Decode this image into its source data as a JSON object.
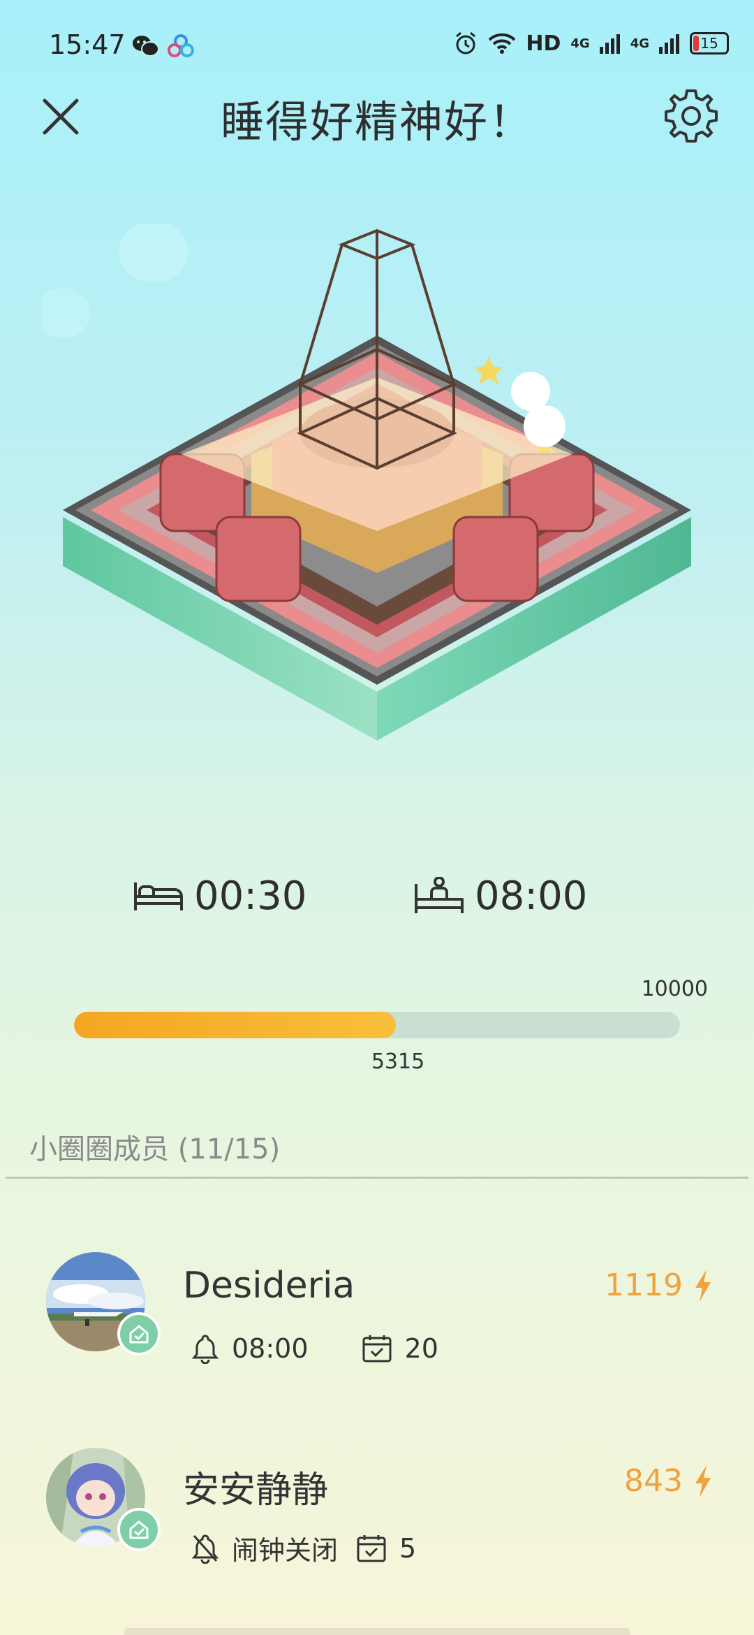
{
  "status_bar": {
    "time": "15:47",
    "network_label": "HD",
    "signal1_label": "4G",
    "signal2_label": "4G",
    "battery": "15",
    "icons": [
      "wechat-icon",
      "app-icon",
      "alarm-icon",
      "wifi-icon",
      "signal-icon",
      "battery-icon"
    ]
  },
  "header": {
    "title": "睡得好精神好！",
    "close_icon": "close-icon",
    "settings_icon": "gear-icon"
  },
  "sleep": {
    "bed_time": "00:30",
    "wake_time": "08:00",
    "bed_icon": "bed-icon",
    "wake_icon": "wake-up-icon"
  },
  "progress": {
    "max_label": "10000",
    "value_label": "5315",
    "value": 5315,
    "max": 10000,
    "fill_color": "#f5a623"
  },
  "members": {
    "label": "小圈圈成员 (11/15)",
    "items": [
      {
        "name": "Desideria",
        "score": "1119",
        "alarm": "08:00",
        "alarm_on": true,
        "days": "20"
      },
      {
        "name": "安安静静",
        "score": "843",
        "alarm": "闹钟关闭",
        "alarm_on": false,
        "days": "5"
      }
    ]
  },
  "colors": {
    "accent": "#f0a23b",
    "verified": "#7ecfa8"
  }
}
